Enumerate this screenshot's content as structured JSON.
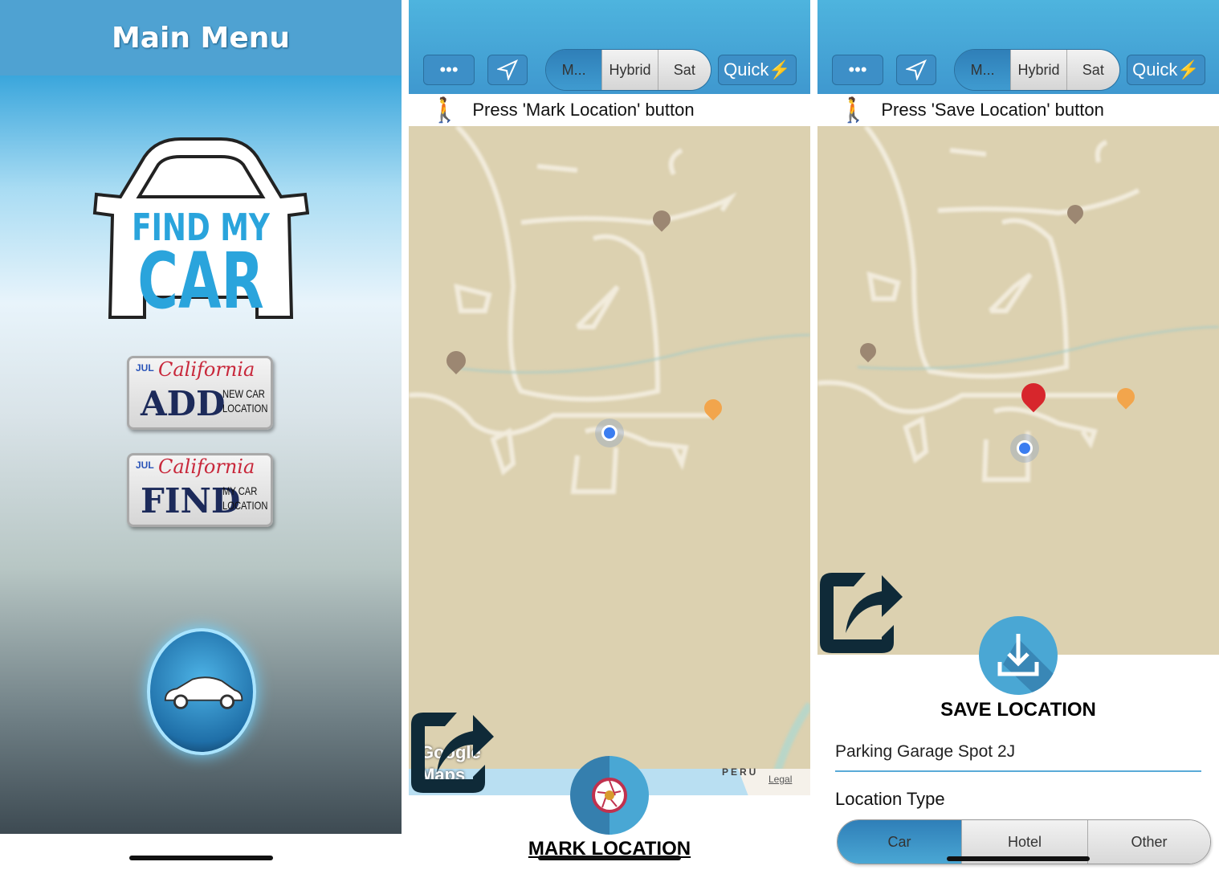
{
  "main_menu": {
    "title": "Main Menu",
    "logo_line1": "FIND MY",
    "logo_line2": "CAR",
    "plates": [
      {
        "state": "California",
        "month": "JUL",
        "big": "ADD",
        "small1": "NEW CAR",
        "small2": "LOCATION"
      },
      {
        "state": "California",
        "month": "JUL",
        "big": "FIND",
        "small1": "MY CAR",
        "small2": "LOCATION"
      }
    ]
  },
  "toolbar": {
    "more_icon": "ellipsis-icon",
    "locate_icon": "location-arrow-icon",
    "map_types": [
      "M...",
      "Hybrid",
      "Sat"
    ],
    "selected_map_type": "M...",
    "quick_label": "Quick",
    "quick_icon": "lightning-icon"
  },
  "mark_screen": {
    "instruction": "Press 'Mark Location' button",
    "map_attribution": "Google Maps",
    "map_country": "PERU",
    "legal": "Legal",
    "button_label": "MARK LOCATION"
  },
  "save_screen": {
    "instruction": "Press 'Save Location' button",
    "button_label": "SAVE LOCATION",
    "name_value": "Parking Garage Spot 2J",
    "type_label": "Location Type",
    "types": [
      "Car",
      "Hotel",
      "Other"
    ],
    "selected_type": "Car"
  },
  "colors": {
    "header_blue": "#4fa2d2",
    "accent": "#4aa7d4",
    "map": "#dcd1b0",
    "pin_red": "#d7262c"
  }
}
